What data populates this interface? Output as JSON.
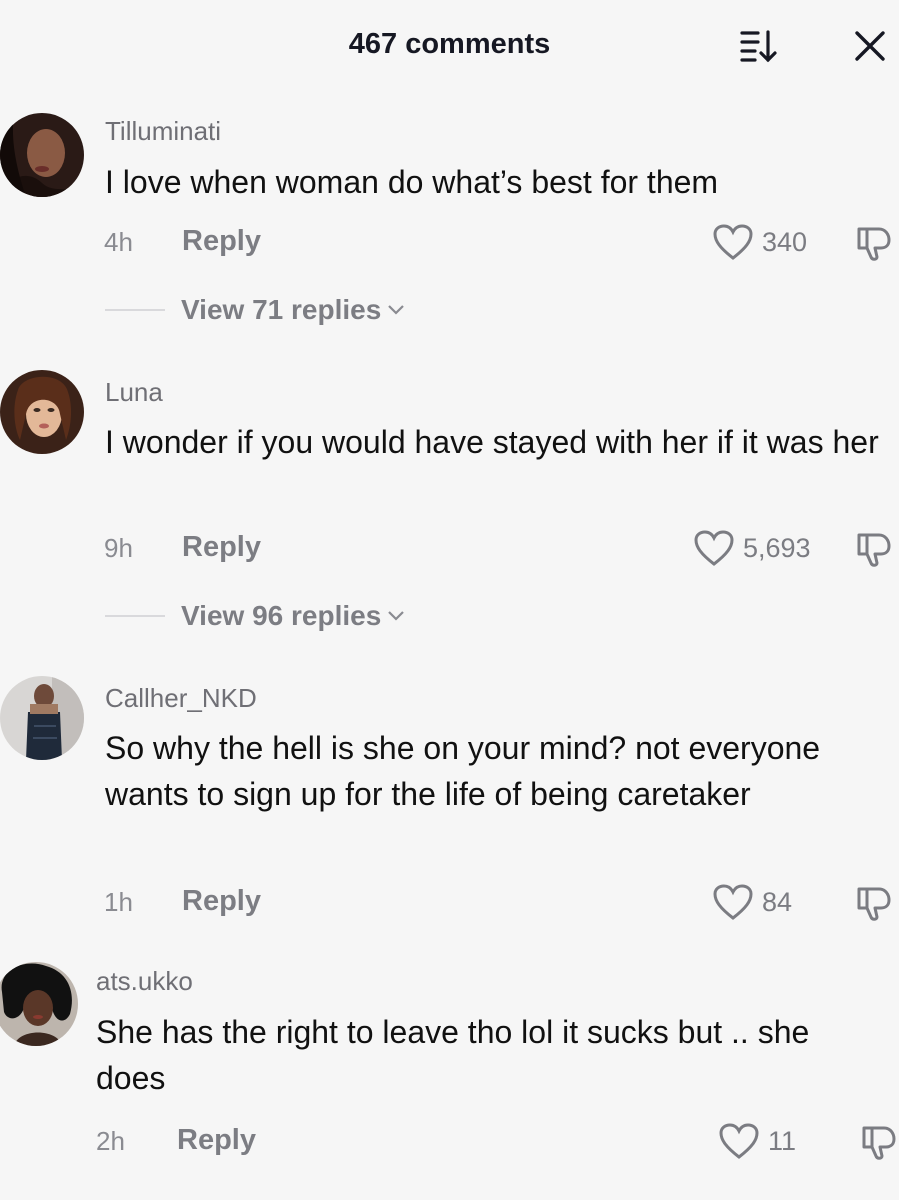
{
  "header": {
    "title": "467 comments",
    "sort_icon": "sort-icon",
    "close_icon": "close-icon"
  },
  "comments": [
    {
      "username": "Tilluminati",
      "text": "I love when woman do what’s best for them",
      "time": "4h",
      "reply_label": "Reply",
      "likes": "340",
      "view_replies": "View 71 replies"
    },
    {
      "username": "Luna",
      "text": "I wonder if you would have stayed with her if it was her",
      "time": "9h",
      "reply_label": "Reply",
      "likes": "5,693",
      "view_replies": "View 96 replies"
    },
    {
      "username": "Callher_NKD",
      "text": "So why the hell is she on your mind? not everyone wants to sign up for the life of being caretaker",
      "time": "1h",
      "reply_label": "Reply",
      "likes": "84"
    },
    {
      "username": "ats.ukko",
      "text": "She has the right to leave tho lol it sucks but .. she does",
      "time": "2h",
      "reply_label": "Reply",
      "likes": "11"
    }
  ],
  "colors": {
    "background": "#f6f6f6",
    "text": "#161823",
    "muted": "#7c7d83"
  }
}
